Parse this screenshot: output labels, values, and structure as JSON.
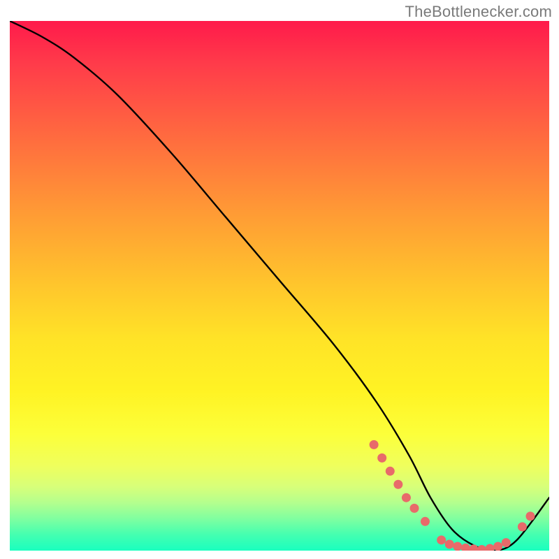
{
  "attribution": "TheBottlenecker.com",
  "chart_data": {
    "type": "line",
    "title": "",
    "xlabel": "",
    "ylabel": "",
    "xlim": [
      0,
      100
    ],
    "ylim": [
      0,
      100
    ],
    "series": [
      {
        "name": "curve",
        "x": [
          0,
          6,
          12,
          20,
          30,
          40,
          50,
          60,
          68,
          74,
          78,
          82,
          86,
          90,
          94,
          100
        ],
        "y": [
          100,
          97,
          93,
          86,
          75,
          63,
          51,
          39,
          28,
          18,
          10,
          4,
          1,
          0,
          2,
          10
        ]
      }
    ],
    "markers": [
      {
        "x": 67.5,
        "y": 20.0
      },
      {
        "x": 69.0,
        "y": 17.5
      },
      {
        "x": 70.5,
        "y": 15.0
      },
      {
        "x": 72.0,
        "y": 12.5
      },
      {
        "x": 73.5,
        "y": 10.0
      },
      {
        "x": 75.0,
        "y": 8.0
      },
      {
        "x": 77.0,
        "y": 5.5
      },
      {
        "x": 80.0,
        "y": 2.0
      },
      {
        "x": 81.5,
        "y": 1.2
      },
      {
        "x": 83.0,
        "y": 0.8
      },
      {
        "x": 84.5,
        "y": 0.5
      },
      {
        "x": 86.0,
        "y": 0.3
      },
      {
        "x": 87.5,
        "y": 0.2
      },
      {
        "x": 89.0,
        "y": 0.4
      },
      {
        "x": 90.5,
        "y": 0.8
      },
      {
        "x": 92.0,
        "y": 1.5
      },
      {
        "x": 95.0,
        "y": 4.5
      },
      {
        "x": 96.5,
        "y": 6.5
      }
    ],
    "gradient_stops": [
      {
        "pos": 0,
        "color": "#ff1a4b"
      },
      {
        "pos": 8,
        "color": "#ff3b4a"
      },
      {
        "pos": 22,
        "color": "#ff6b3f"
      },
      {
        "pos": 36,
        "color": "#ff9a35"
      },
      {
        "pos": 50,
        "color": "#ffc62c"
      },
      {
        "pos": 60,
        "color": "#ffe327"
      },
      {
        "pos": 70,
        "color": "#fff324"
      },
      {
        "pos": 78,
        "color": "#fcff3a"
      },
      {
        "pos": 84,
        "color": "#efff5d"
      },
      {
        "pos": 88,
        "color": "#d7ff7a"
      },
      {
        "pos": 91,
        "color": "#b3ff8e"
      },
      {
        "pos": 94,
        "color": "#7fffa0"
      },
      {
        "pos": 97,
        "color": "#44ffb0"
      },
      {
        "pos": 100,
        "color": "#19ffbf"
      }
    ],
    "curve_color": "#000000",
    "marker_color": "#e86a6a"
  }
}
